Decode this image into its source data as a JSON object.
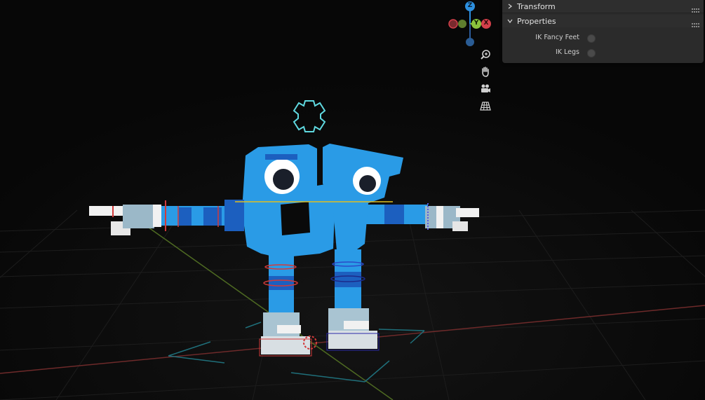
{
  "viewport": {
    "gizmo": {
      "z": "Z",
      "y": "Y",
      "x": "X"
    },
    "navigation": [
      {
        "name": "zoom-icon"
      },
      {
        "name": "hand-icon"
      },
      {
        "name": "camera-icon"
      },
      {
        "name": "grid-icon"
      }
    ]
  },
  "sidebar": {
    "panels": [
      {
        "title": "Transform",
        "expanded": false
      },
      {
        "title": "Properties",
        "expanded": true
      }
    ],
    "properties": [
      {
        "label": "IK Fancy Feet",
        "checked": false
      },
      {
        "label": "IK Legs",
        "checked": false
      }
    ]
  },
  "colors": {
    "background": "#0a0a0a",
    "panel": "#2b2b2b",
    "axis_x": "#d3404a",
    "axis_y": "#8ac33d",
    "axis_z": "#2c8fdf",
    "character_blue": "#2a9be6",
    "character_dark_blue": "#1c5fbf"
  }
}
